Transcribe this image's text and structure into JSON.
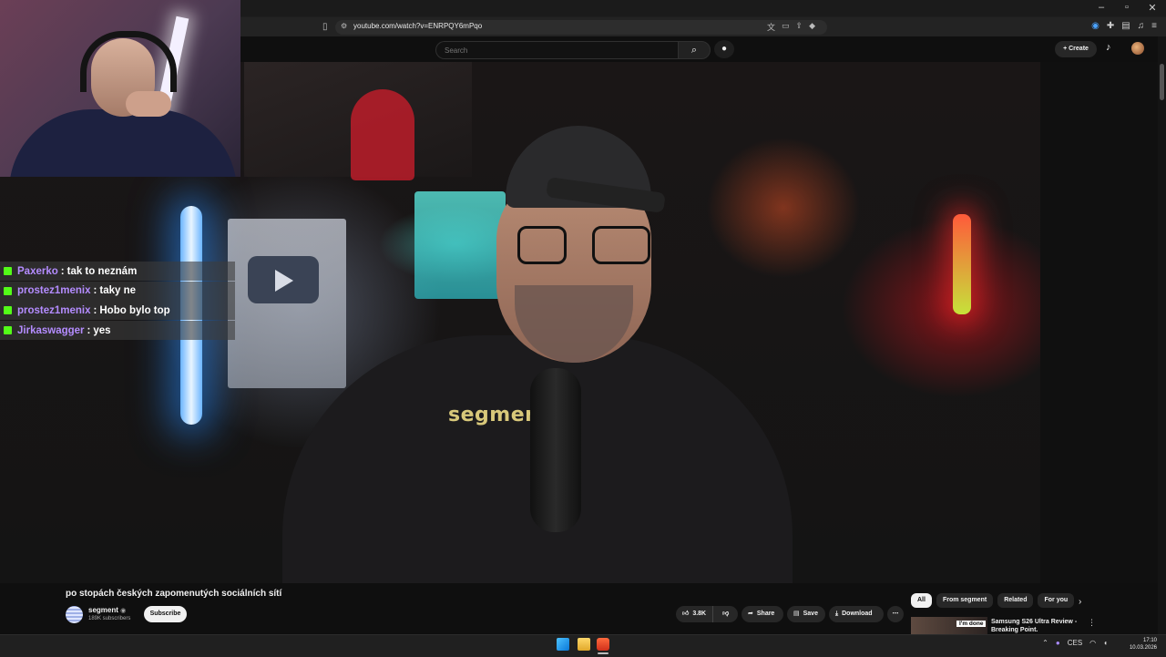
{
  "browser": {
    "url": "youtube.com/watch?v=ENRPQY6mPqo",
    "window_controls": [
      "–",
      "▫",
      "✕"
    ]
  },
  "youtube": {
    "search_placeholder": "Search",
    "create_label": "Create"
  },
  "chat": [
    {
      "user": "Paxerko",
      "message": "tak to neznám"
    },
    {
      "user": "prostez1menix",
      "message": "taky ne"
    },
    {
      "user": "prostez1menix",
      "message": "Hobo bylo top"
    },
    {
      "user": "Jirkaswagger",
      "message": "yes"
    }
  ],
  "video": {
    "shirt_text": "segmen",
    "title": "po stopách českých zapomenutých sociálních sítí",
    "channel": "segment",
    "subscribers": "189K subscribers",
    "subscribe_label": "Subscribe",
    "likes": "3.8K",
    "share_label": "Share",
    "save_label": "Save",
    "download_label": "Download"
  },
  "chips": [
    "All",
    "From segment",
    "Related",
    "For you"
  ],
  "recommendation": {
    "badge": "I'm done",
    "title": "Samsung S26 Ultra Review - Breaking Point."
  },
  "taskbar": {
    "language": "CES",
    "time": "17:10",
    "date": "10.03.2026"
  },
  "colors": {
    "chat_username": "#b48cff",
    "kick_green": "#53fc18",
    "yt_background": "#0f0f0f"
  }
}
